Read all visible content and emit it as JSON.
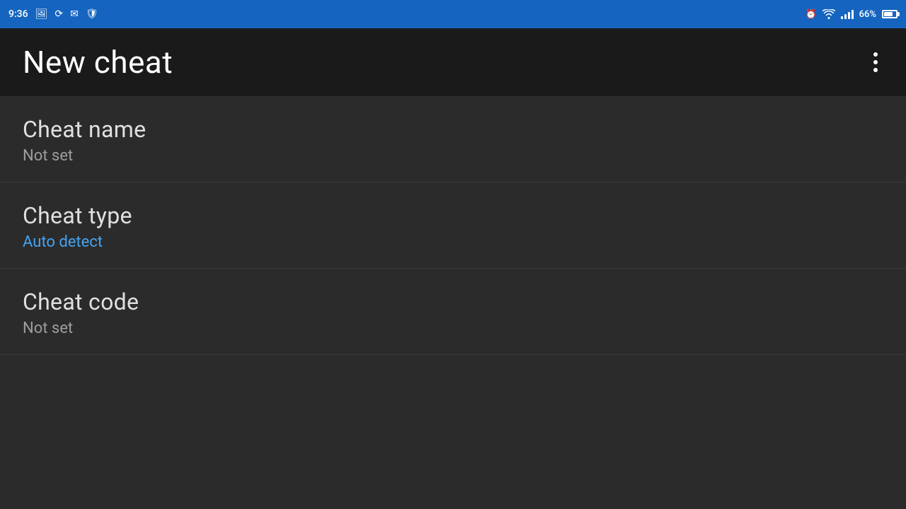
{
  "statusBar": {
    "time": "9:36",
    "batteryPercent": "66%",
    "icons": {
      "alarm": "⏰",
      "wifi": "wifi",
      "signal": "signal",
      "battery": "battery"
    }
  },
  "appBar": {
    "title": "New cheat",
    "moreOptions": "⋮"
  },
  "listItems": [
    {
      "id": "cheat-name",
      "title": "Cheat name",
      "subtitle": "Not set",
      "subtitleStyle": "not-set"
    },
    {
      "id": "cheat-type",
      "title": "Cheat type",
      "subtitle": "Auto detect",
      "subtitleStyle": "auto-detect"
    },
    {
      "id": "cheat-code",
      "title": "Cheat code",
      "subtitle": "Not set",
      "subtitleStyle": "not-set"
    }
  ]
}
